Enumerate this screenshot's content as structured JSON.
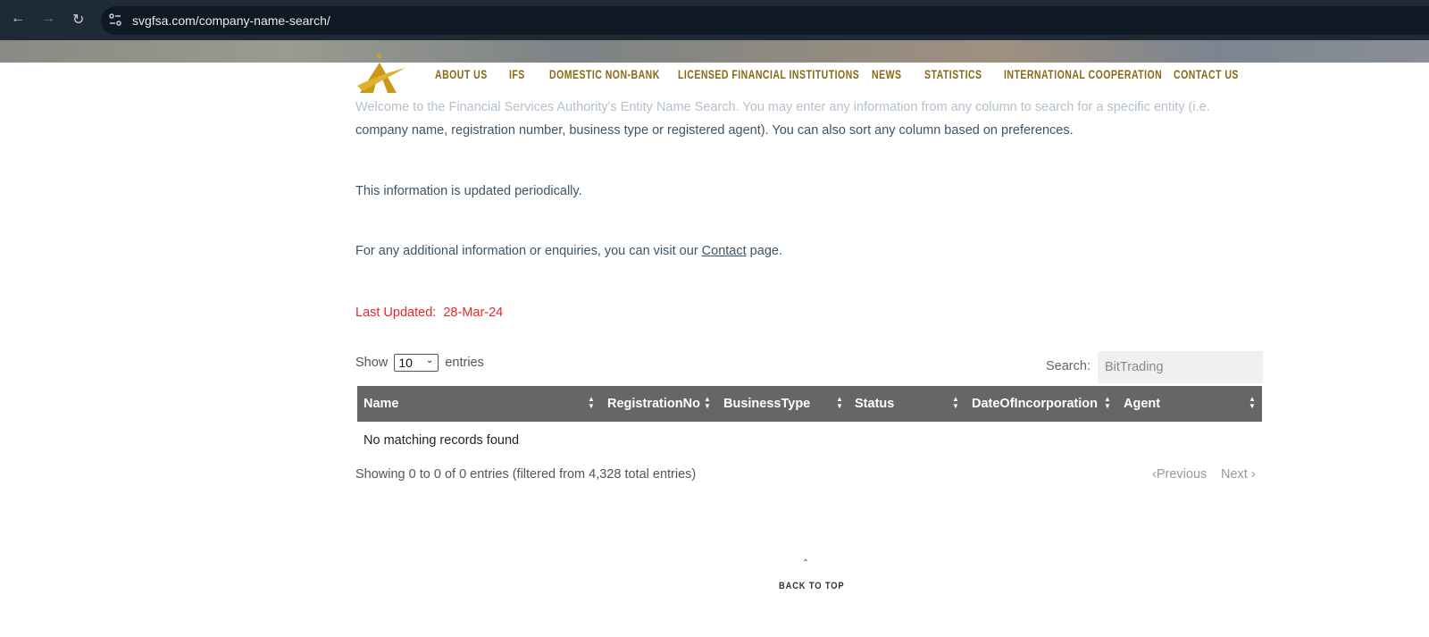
{
  "browser": {
    "url": "svgfsa.com/company-name-search/",
    "icons": [
      "back-arrow-icon",
      "forward-arrow-icon",
      "reload-icon",
      "site-settings-icon"
    ]
  },
  "nav": {
    "items": [
      "ABOUT US",
      "IFS",
      "DOMESTIC NON-BANK",
      "LICENSED FINANCIAL INSTITUTIONS",
      "NEWS",
      "STATISTICS",
      "INTERNATIONAL COOPERATION",
      "CONTACT US"
    ],
    "color": "#8b6914"
  },
  "content": {
    "intro_line1": "Welcome to the Financial Services Authority's Entity Name Search. You may enter any information from any column to search for a specific entity (i.e.",
    "intro_line2": "company name, registration number, business type or registered agent). You can also sort any column based on preferences.",
    "updated_note": "This information is updated periodically.",
    "contact_pre": "For any additional information or enquiries, you can visit our ",
    "contact_link": "Contact",
    "contact_post": " page.",
    "last_updated_label": "Last Updated:",
    "last_updated_value": "28-Mar-24",
    "last_updated_color": "#e8272a"
  },
  "table": {
    "show_label": "Show",
    "entries_label": "entries",
    "page_size": "10",
    "search_label": "Search:",
    "search_value": "BitTrading",
    "columns": [
      "Name",
      "RegistrationNo",
      "BusinessType",
      "Status",
      "DateOfIncorporation",
      "Agent"
    ],
    "empty_message": "No matching records found",
    "info": "Showing 0 to 0 of 0 entries (filtered from 4,328 total entries)",
    "prev": "Previous",
    "next": "Next",
    "header_color": "#666666"
  },
  "footer": {
    "back_to_top": "BACK TO TOP"
  }
}
